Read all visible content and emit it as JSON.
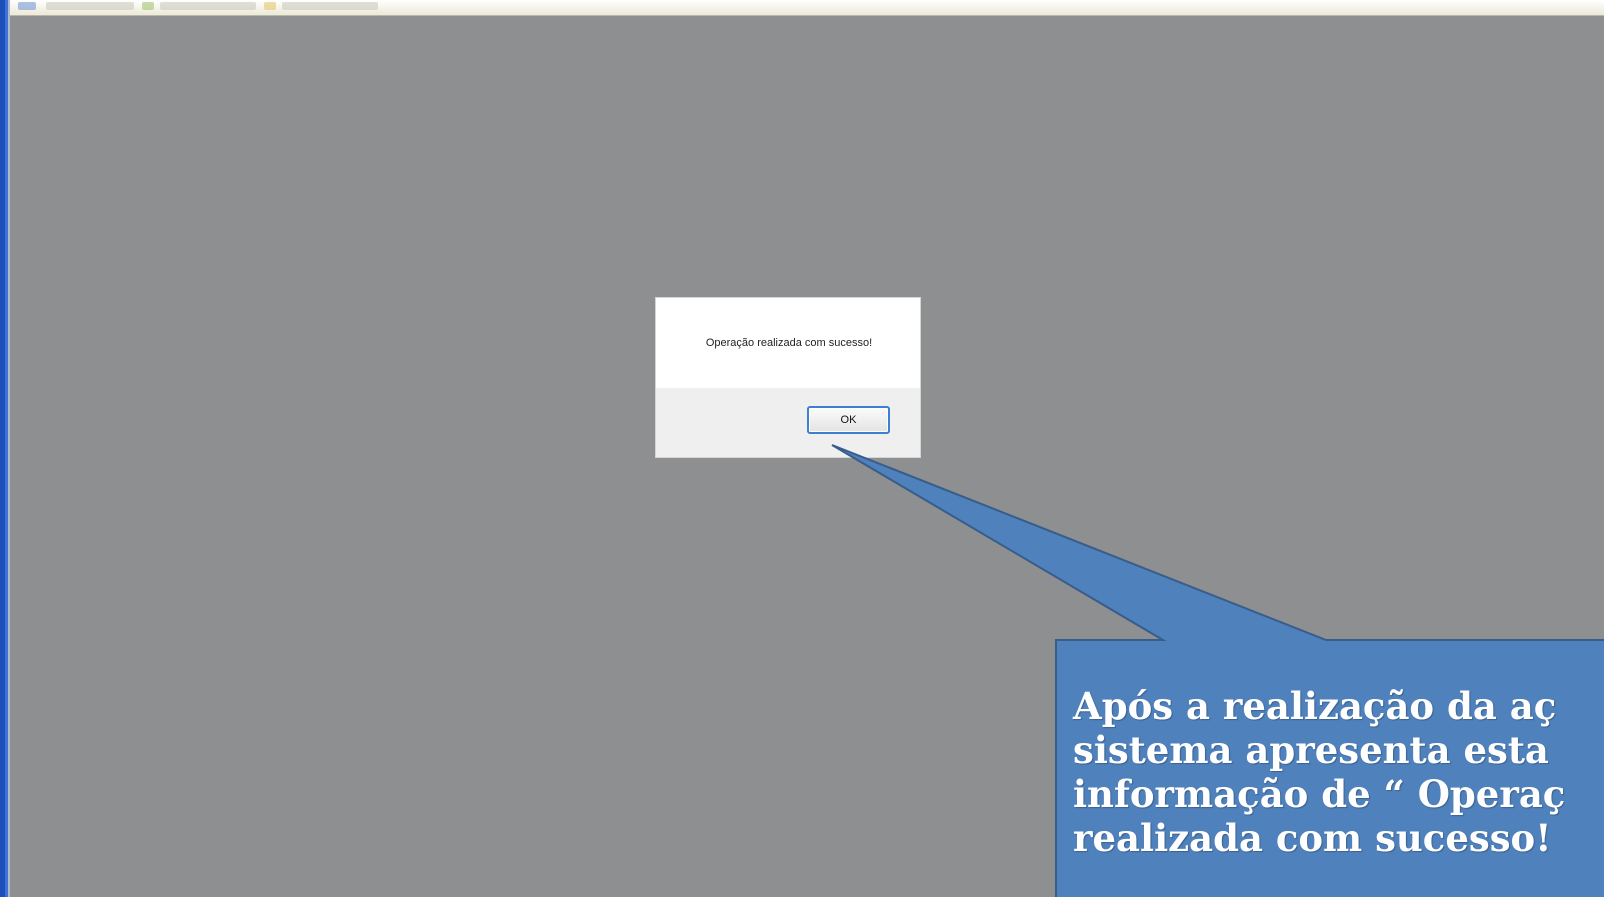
{
  "screen": {
    "background_color": "#8e8f90",
    "top_bar_color": "#ece9d8",
    "left_edge_color": "#1d4fb8"
  },
  "dialog": {
    "message": "Operação realizada com sucesso!",
    "ok_label": "OK",
    "accent_color": "#3e7fd0"
  },
  "callout": {
    "text": "Após a realização da aç\nsistema apresenta esta\ninformação de “ Operaç\nrealizada com sucesso!",
    "fill_color": "#4f81bd",
    "border_color": "#385d8a"
  }
}
